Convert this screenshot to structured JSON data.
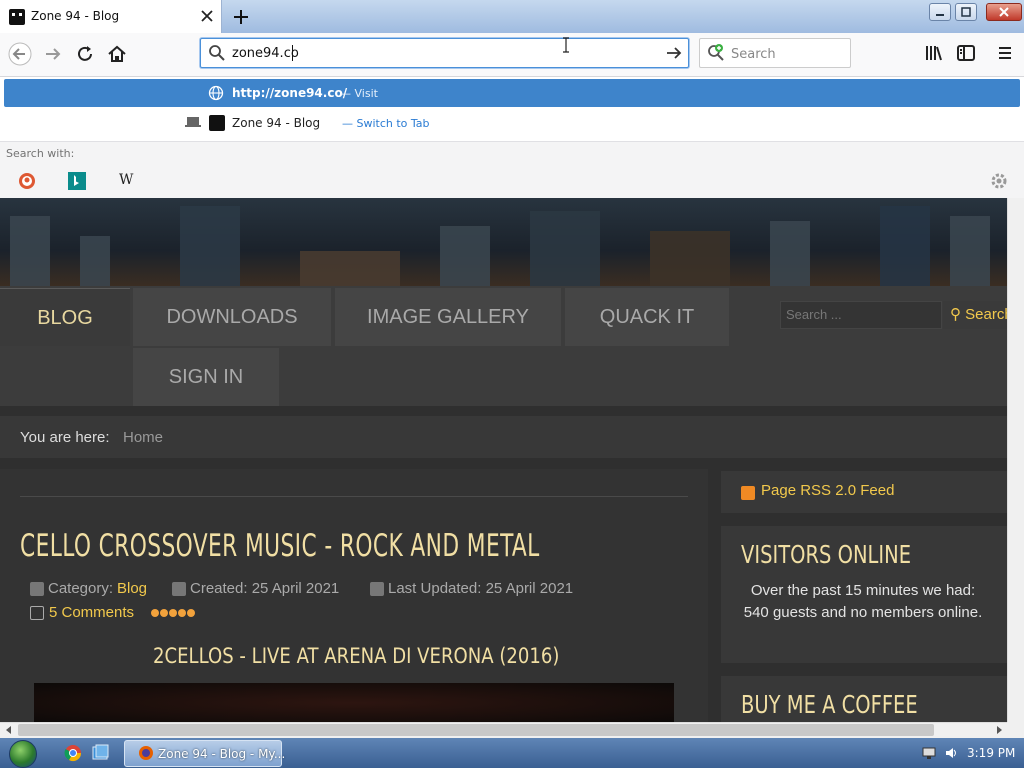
{
  "browser": {
    "tab": {
      "title": "Zone 94 - Blog"
    },
    "urlbar": {
      "value": "zone94.co"
    },
    "searchbar": {
      "placeholder": "Search"
    }
  },
  "autocomplete": {
    "rows": [
      {
        "label": "http://zone94.co/",
        "action": "— Visit"
      },
      {
        "label": "Zone 94 - Blog",
        "action": "— Switch to Tab"
      }
    ],
    "search_with_label": "Search with:",
    "engines": [
      "duckduckgo-icon",
      "bing-icon",
      "wikipedia-icon"
    ]
  },
  "page": {
    "menu": [
      "BLOG",
      "DOWNLOADS",
      "IMAGE GALLERY",
      "QUACK IT",
      "SIGN IN"
    ],
    "search": {
      "placeholder": "Search ...",
      "button": "Search"
    },
    "breadcrumb": {
      "label": "You are here:",
      "home": "Home"
    },
    "article": {
      "title": "CELLO CROSSOVER MUSIC - ROCK AND METAL",
      "category_prefix": "Category:",
      "category": "Blog",
      "created": "Created: 25 April 2021",
      "updated": "Last Updated: 25 April 2021",
      "comments": "5 Comments",
      "video_title": "2CELLOS - LIVE AT ARENA DI VERONA (2016)"
    },
    "sidebar": {
      "rss": "Page RSS 2.0 Feed",
      "visitors_title": "VISITORS ONLINE",
      "visitors_text": "Over the past 15 minutes we had: 540 guests and no members online.",
      "coffee_title": "BUY ME A COFFEE"
    }
  },
  "taskbar": {
    "active_window": "Zone 94 - Blog - My...",
    "clock": "3:19 PM"
  },
  "colors": {
    "accent": "#3e84cb",
    "page_bg": "#2f2f2f",
    "gold": "#f2c94c"
  }
}
